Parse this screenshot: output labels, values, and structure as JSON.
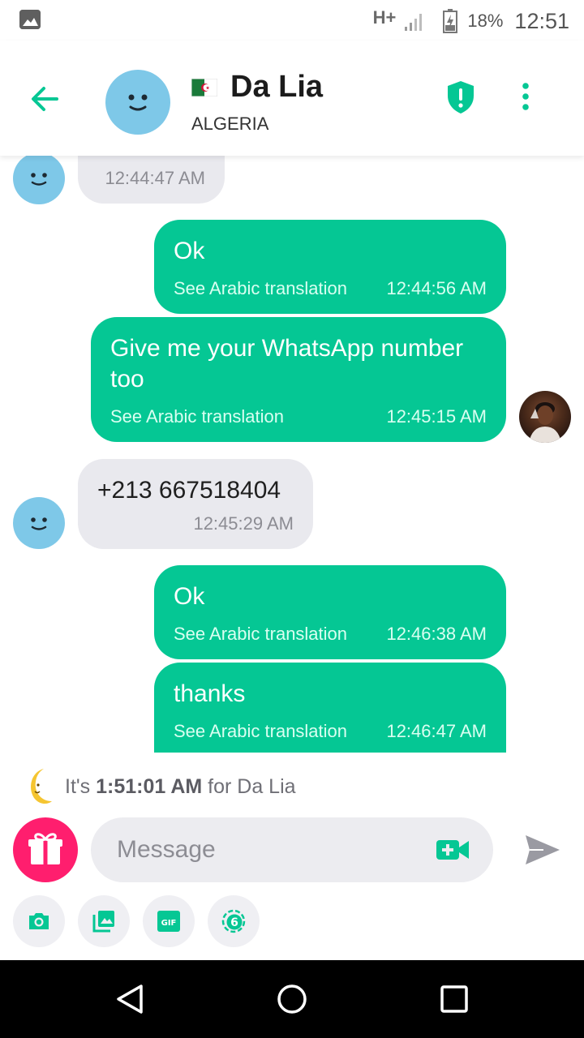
{
  "status_bar": {
    "network": "H+",
    "battery_percent": "18%",
    "time": "12:51"
  },
  "header": {
    "contact_name": "Da Lia",
    "country": "ALGERIA"
  },
  "messages": [
    {
      "direction": "in",
      "text": "",
      "time": "12:44:47 AM"
    },
    {
      "direction": "out",
      "text": "Ok",
      "translation": "See Arabic translation",
      "time": "12:44:56 AM"
    },
    {
      "direction": "out",
      "text_line1": "Give me your WhatsApp number",
      "text_line2": "too",
      "translation": "See Arabic translation",
      "time": "12:45:15 AM"
    },
    {
      "direction": "in",
      "text": "+213 667518404",
      "time": "12:45:29 AM"
    },
    {
      "direction": "out",
      "text": "Ok",
      "translation": "See Arabic translation",
      "time": "12:46:38 AM"
    },
    {
      "direction": "out",
      "text": "thanks",
      "translation": "See Arabic translation",
      "time": "12:46:47 AM"
    }
  ],
  "local_time": {
    "prefix": "It's",
    "time": "1:51:01 AM",
    "suffix": "for Da Lia"
  },
  "composer": {
    "placeholder": "Message"
  },
  "tools": [
    "camera-icon",
    "gallery-icon",
    "gif-icon",
    "timer-6-icon"
  ],
  "colors": {
    "accent": "#05c794",
    "incoming_bubble": "#e9e9ee",
    "gift": "#ff1e6e",
    "avatar": "#7ec8e8"
  }
}
